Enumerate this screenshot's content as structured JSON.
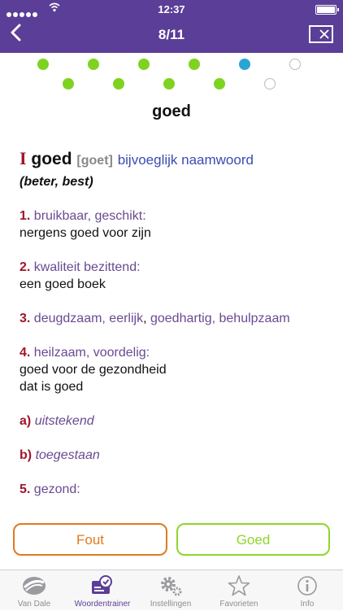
{
  "status": {
    "time": "12:37"
  },
  "header": {
    "title": "8/11"
  },
  "progress": {
    "states": [
      "done",
      "done",
      "done",
      "done",
      "done",
      "done",
      "done",
      "done",
      "current",
      "pending",
      "pending"
    ]
  },
  "colors": {
    "header": "#5b3e97",
    "done": "#7ed321",
    "current": "#2aa3d5",
    "wrong": "#e07a1f",
    "right": "#8ed62a",
    "number": "#a0162a",
    "meaning": "#6a4a92",
    "pos": "#3b4bb4"
  },
  "word": "goed",
  "entry": {
    "roman": "I",
    "lemma": "goed",
    "pronunciation": "[goet]",
    "part_of_speech": "bijvoeglijk naamwoord",
    "forms": "(beter, best)",
    "senses": [
      {
        "num": "1.",
        "meaning": "bruikbaar, geschikt:",
        "examples": [
          "nergens goed voor zijn"
        ]
      },
      {
        "num": "2.",
        "meaning": "kwaliteit bezittend:",
        "examples": [
          "een goed boek"
        ]
      },
      {
        "num": "3.",
        "meaning_a": "deugdzaam, eerlijk",
        "meaning_sep": ", ",
        "meaning_b": "goedhartig, behulpzaam"
      },
      {
        "num": "4.",
        "meaning": "heilzaam, voordelig:",
        "examples": [
          "goed voor de gezondheid",
          "dat is goed"
        ]
      },
      {
        "num": "a)",
        "italic": "uitstekend"
      },
      {
        "num": "b)",
        "italic": "toegestaan"
      },
      {
        "num": "5.",
        "meaning": "gezond:"
      }
    ]
  },
  "buttons": {
    "wrong": "Fout",
    "right": "Goed"
  },
  "tabs": [
    {
      "label": "Van Dale",
      "icon": "van-dale-logo-icon"
    },
    {
      "label": "Woordentrainer",
      "icon": "trainer-icon"
    },
    {
      "label": "Instellingen",
      "icon": "gear-icon"
    },
    {
      "label": "Favorieten",
      "icon": "star-icon"
    },
    {
      "label": "Info",
      "icon": "info-icon"
    }
  ]
}
